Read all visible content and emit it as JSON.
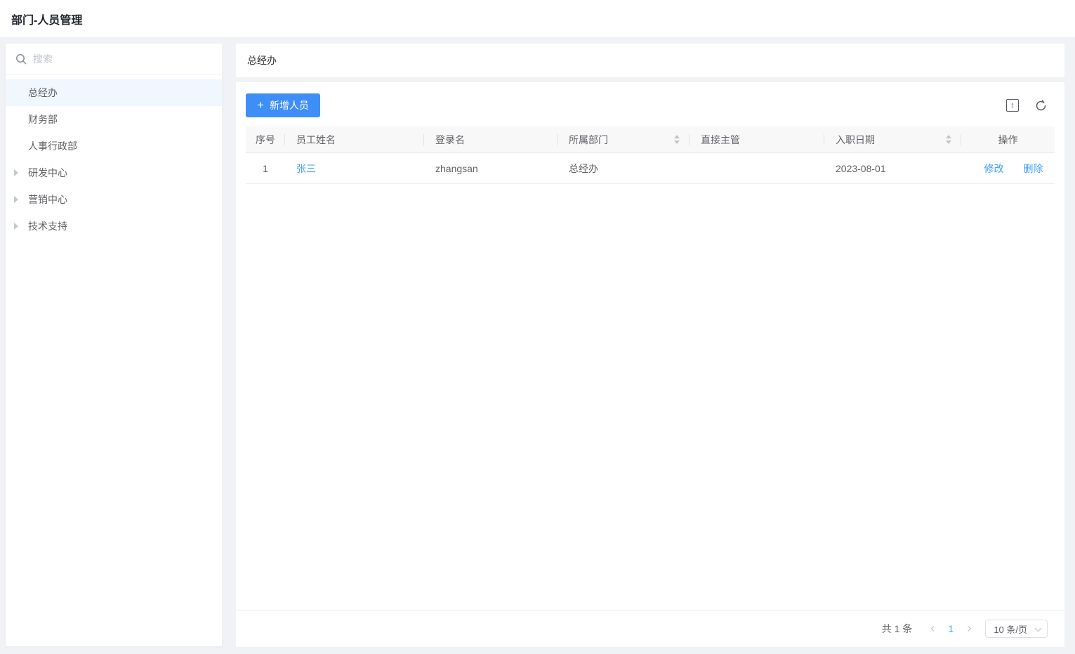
{
  "header": {
    "title": "部门-人员管理"
  },
  "sidebar": {
    "search_placeholder": "搜索",
    "tree": [
      {
        "label": "总经办",
        "selected": true,
        "expandable": false
      },
      {
        "label": "财务部",
        "selected": false,
        "expandable": false
      },
      {
        "label": "人事行政部",
        "selected": false,
        "expandable": false
      },
      {
        "label": "研发中心",
        "selected": false,
        "expandable": true
      },
      {
        "label": "营销中心",
        "selected": false,
        "expandable": true
      },
      {
        "label": "技术支持",
        "selected": false,
        "expandable": true
      }
    ]
  },
  "main": {
    "panel_title": "总经办",
    "toolbar": {
      "add_button_label": "新增人员"
    },
    "table": {
      "columns": [
        {
          "label": "序号",
          "sortable": false
        },
        {
          "label": "员工姓名",
          "sortable": false
        },
        {
          "label": "登录名",
          "sortable": false
        },
        {
          "label": "所属部门",
          "sortable": true
        },
        {
          "label": "直接主管",
          "sortable": false
        },
        {
          "label": "入职日期",
          "sortable": true
        },
        {
          "label": "操作",
          "sortable": false
        }
      ],
      "rows": [
        {
          "no": "1",
          "name": "张三",
          "login": "zhangsan",
          "dept": "总经办",
          "supervisor": "",
          "date": "2023-08-01",
          "edit": "修改",
          "delete": "删除"
        }
      ]
    },
    "pagination": {
      "total": "共 1 条",
      "prev": "‹",
      "page": "1",
      "next": "›",
      "page_size": "10 条/页"
    }
  },
  "icons": {
    "search": "magnifier",
    "plus": "+",
    "row_height": "↕",
    "refresh": "circular-arrow",
    "caret_right": "triangle-right",
    "sort": "up-down-triangles",
    "select_caret": "chevron-down"
  },
  "colors": {
    "accent": "#409eff",
    "button": "#3e8ef7",
    "page-bg": "#f0f2f5",
    "card-bg": "#ffffff",
    "text": "#606266",
    "muted": "#c0c4cc",
    "border": "#e8eaec",
    "header-bg": "#f8f8f9",
    "selected-bg": "#f0f7ff"
  }
}
